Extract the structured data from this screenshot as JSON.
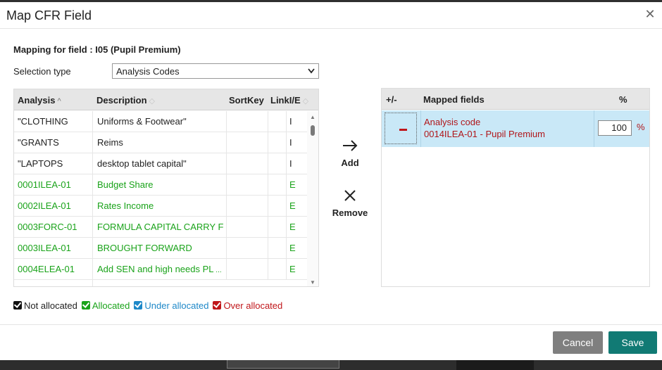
{
  "dialog": {
    "title": "Map CFR Field",
    "close_glyph": "✕"
  },
  "mapping": {
    "label": "Mapping for field : I05 (Pupil Premium)",
    "selection_type_label": "Selection type",
    "selection_type_value": "Analysis Codes"
  },
  "grid": {
    "columns": [
      "Analysis",
      "Description",
      "SortKey",
      "LinkI/E"
    ],
    "rows": [
      {
        "analysis": "\"CLOTHING",
        "description": "Uniforms & Footwear\"",
        "sortkey": "",
        "link": "",
        "ie": "I",
        "status": "not_allocated",
        "truncated": false
      },
      {
        "analysis": "\"GRANTS",
        "description": "Reims",
        "sortkey": "",
        "link": "",
        "ie": "I",
        "status": "not_allocated",
        "truncated": false
      },
      {
        "analysis": "\"LAPTOPS",
        "description": "desktop tablet capital\"",
        "sortkey": "",
        "link": "",
        "ie": "I",
        "status": "not_allocated",
        "truncated": false
      },
      {
        "analysis": "0001ILEA-01",
        "description": "Budget Share",
        "sortkey": "",
        "link": "",
        "ie": "E",
        "status": "allocated",
        "truncated": false
      },
      {
        "analysis": "0002ILEA-01",
        "description": "Rates Income",
        "sortkey": "",
        "link": "",
        "ie": "E",
        "status": "allocated",
        "truncated": false
      },
      {
        "analysis": "0003FORC-01",
        "description": "FORMULA CAPITAL CARRY F",
        "sortkey": "",
        "link": "",
        "ie": "E",
        "status": "allocated",
        "truncated": true
      },
      {
        "analysis": "0003ILEA-01",
        "description": "BROUGHT FORWARD",
        "sortkey": "",
        "link": "",
        "ie": "E",
        "status": "allocated",
        "truncated": false
      },
      {
        "analysis": "0004ELEA-01",
        "description": "Add SEN and high needs PL",
        "sortkey": "",
        "link": "",
        "ie": "E",
        "status": "allocated",
        "truncated": true
      }
    ]
  },
  "actions": {
    "add_label": "Add",
    "remove_label": "Remove"
  },
  "mapped": {
    "col_plusminus": "+/-",
    "col_fields": "Mapped fields",
    "col_pct": "%",
    "rows": [
      {
        "line1": "Analysis code",
        "line2": "0014ILEA-01 - Pupil Premium",
        "pct": "100",
        "pct_sign": "%"
      }
    ]
  },
  "legend": [
    {
      "label": "Not allocated",
      "color": "#111111"
    },
    {
      "label": "Allocated",
      "color": "#1aa31a"
    },
    {
      "label": "Under allocated",
      "color": "#1e88c8"
    },
    {
      "label": "Over allocated",
      "color": "#c0161a"
    }
  ],
  "footer": {
    "cancel_label": "Cancel",
    "save_label": "Save"
  },
  "colors": {
    "allocated_text": "#1aa31a",
    "over_text": "#b0161a",
    "save_bg": "#117a74",
    "cancel_bg": "#7f7f7f",
    "selected_row_bg": "#c9e8f7"
  }
}
